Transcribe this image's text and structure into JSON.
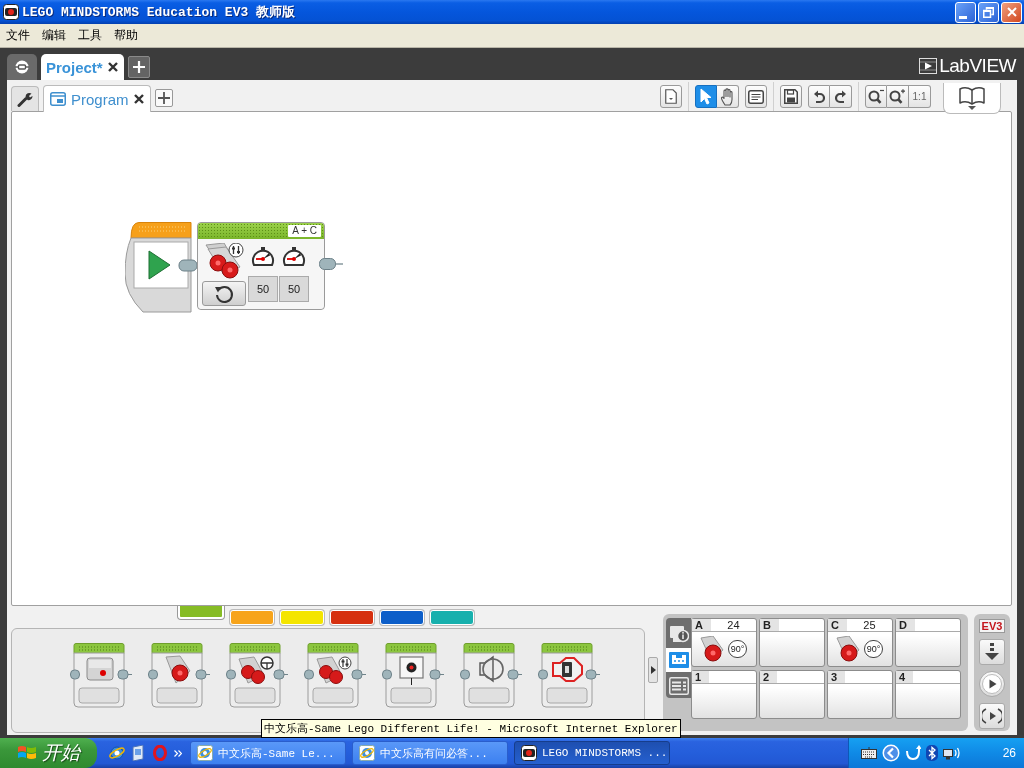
{
  "window": {
    "title": "LEGO MINDSTORMS Education EV3 教师版"
  },
  "menu": [
    "文件",
    "编辑",
    "工具",
    "帮助"
  ],
  "project_tabs": [
    {
      "label": "Project*",
      "selected": true
    }
  ],
  "logo": {
    "text": "LabVIEW"
  },
  "program_tabs": [
    {
      "label": "Program",
      "selected": true
    }
  ],
  "toolbar": {
    "tools": [
      {
        "kind": "select",
        "selected": true
      },
      {
        "kind": "pan",
        "selected": false
      }
    ],
    "zoom_reset": "1:1"
  },
  "program": {
    "blocks": [
      {
        "kind": "start"
      },
      {
        "kind": "move-tank",
        "ports": "A + C",
        "inputs": [
          "50",
          "50"
        ]
      }
    ]
  },
  "palette": {
    "tabs": [
      {
        "color": "#86bc25",
        "selected": true
      },
      {
        "color": "#f7a41b",
        "selected": false
      },
      {
        "color": "#f4e500",
        "selected": false
      },
      {
        "color": "#d6300f",
        "selected": false
      },
      {
        "color": "#0c5ec9",
        "selected": false
      },
      {
        "color": "#17b0ad",
        "selected": false
      }
    ],
    "blocks": [
      {
        "kind": "medium-motor"
      },
      {
        "kind": "large-motor"
      },
      {
        "kind": "move-steering"
      },
      {
        "kind": "move-tank"
      },
      {
        "kind": "display"
      },
      {
        "kind": "sound"
      },
      {
        "kind": "brick-light"
      }
    ]
  },
  "hardware": {
    "tabs": [
      {
        "kind": "brick-info",
        "selected": false
      },
      {
        "kind": "port-view",
        "selected": true
      },
      {
        "kind": "available-bricks",
        "selected": false
      }
    ],
    "ports": [
      {
        "port": "A",
        "reading": "24",
        "kind": "motor",
        "mode": "90°"
      },
      {
        "port": "B",
        "kind": "empty"
      },
      {
        "port": "C",
        "reading": "25",
        "kind": "motor",
        "mode": "90°"
      },
      {
        "port": "D",
        "kind": "empty"
      },
      {
        "port": "1",
        "kind": "empty"
      },
      {
        "port": "2",
        "kind": "empty"
      },
      {
        "port": "3",
        "kind": "empty"
      },
      {
        "port": "4",
        "kind": "empty"
      }
    ],
    "brick_label": "EV3"
  },
  "tooltip": "中文乐高-Same Lego Different Life! - Microsoft Internet Explorer",
  "taskbar": {
    "start": "开始",
    "tasks": [
      {
        "kind": "browser",
        "label": "中文乐高-Same Le...",
        "selected": false
      },
      {
        "kind": "browser",
        "label": "中文乐高有问必答...",
        "selected": false
      },
      {
        "kind": "lego",
        "label": "LEGO MINDSTORMS ...",
        "selected": true
      }
    ],
    "clock": "26"
  }
}
